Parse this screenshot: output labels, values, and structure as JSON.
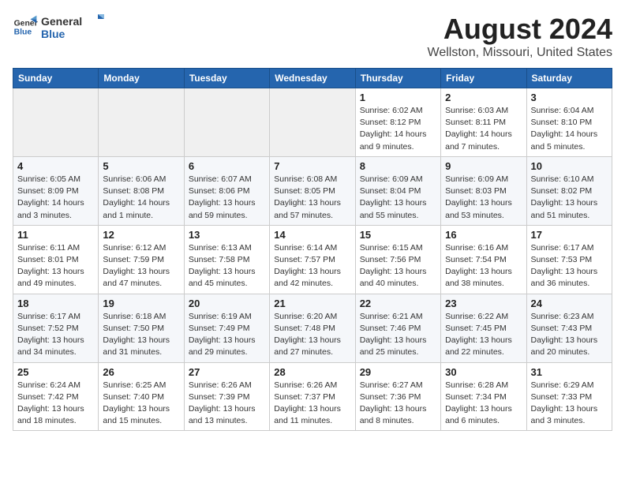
{
  "header": {
    "logo": {
      "line1": "General",
      "line2": "Blue"
    },
    "title": "August 2024",
    "subtitle": "Wellston, Missouri, United States"
  },
  "days_of_week": [
    "Sunday",
    "Monday",
    "Tuesday",
    "Wednesday",
    "Thursday",
    "Friday",
    "Saturday"
  ],
  "weeks": [
    [
      {
        "day": "",
        "info": ""
      },
      {
        "day": "",
        "info": ""
      },
      {
        "day": "",
        "info": ""
      },
      {
        "day": "",
        "info": ""
      },
      {
        "day": "1",
        "info": "Sunrise: 6:02 AM\nSunset: 8:12 PM\nDaylight: 14 hours\nand 9 minutes."
      },
      {
        "day": "2",
        "info": "Sunrise: 6:03 AM\nSunset: 8:11 PM\nDaylight: 14 hours\nand 7 minutes."
      },
      {
        "day": "3",
        "info": "Sunrise: 6:04 AM\nSunset: 8:10 PM\nDaylight: 14 hours\nand 5 minutes."
      }
    ],
    [
      {
        "day": "4",
        "info": "Sunrise: 6:05 AM\nSunset: 8:09 PM\nDaylight: 14 hours\nand 3 minutes."
      },
      {
        "day": "5",
        "info": "Sunrise: 6:06 AM\nSunset: 8:08 PM\nDaylight: 14 hours\nand 1 minute."
      },
      {
        "day": "6",
        "info": "Sunrise: 6:07 AM\nSunset: 8:06 PM\nDaylight: 13 hours\nand 59 minutes."
      },
      {
        "day": "7",
        "info": "Sunrise: 6:08 AM\nSunset: 8:05 PM\nDaylight: 13 hours\nand 57 minutes."
      },
      {
        "day": "8",
        "info": "Sunrise: 6:09 AM\nSunset: 8:04 PM\nDaylight: 13 hours\nand 55 minutes."
      },
      {
        "day": "9",
        "info": "Sunrise: 6:09 AM\nSunset: 8:03 PM\nDaylight: 13 hours\nand 53 minutes."
      },
      {
        "day": "10",
        "info": "Sunrise: 6:10 AM\nSunset: 8:02 PM\nDaylight: 13 hours\nand 51 minutes."
      }
    ],
    [
      {
        "day": "11",
        "info": "Sunrise: 6:11 AM\nSunset: 8:01 PM\nDaylight: 13 hours\nand 49 minutes."
      },
      {
        "day": "12",
        "info": "Sunrise: 6:12 AM\nSunset: 7:59 PM\nDaylight: 13 hours\nand 47 minutes."
      },
      {
        "day": "13",
        "info": "Sunrise: 6:13 AM\nSunset: 7:58 PM\nDaylight: 13 hours\nand 45 minutes."
      },
      {
        "day": "14",
        "info": "Sunrise: 6:14 AM\nSunset: 7:57 PM\nDaylight: 13 hours\nand 42 minutes."
      },
      {
        "day": "15",
        "info": "Sunrise: 6:15 AM\nSunset: 7:56 PM\nDaylight: 13 hours\nand 40 minutes."
      },
      {
        "day": "16",
        "info": "Sunrise: 6:16 AM\nSunset: 7:54 PM\nDaylight: 13 hours\nand 38 minutes."
      },
      {
        "day": "17",
        "info": "Sunrise: 6:17 AM\nSunset: 7:53 PM\nDaylight: 13 hours\nand 36 minutes."
      }
    ],
    [
      {
        "day": "18",
        "info": "Sunrise: 6:17 AM\nSunset: 7:52 PM\nDaylight: 13 hours\nand 34 minutes."
      },
      {
        "day": "19",
        "info": "Sunrise: 6:18 AM\nSunset: 7:50 PM\nDaylight: 13 hours\nand 31 minutes."
      },
      {
        "day": "20",
        "info": "Sunrise: 6:19 AM\nSunset: 7:49 PM\nDaylight: 13 hours\nand 29 minutes."
      },
      {
        "day": "21",
        "info": "Sunrise: 6:20 AM\nSunset: 7:48 PM\nDaylight: 13 hours\nand 27 minutes."
      },
      {
        "day": "22",
        "info": "Sunrise: 6:21 AM\nSunset: 7:46 PM\nDaylight: 13 hours\nand 25 minutes."
      },
      {
        "day": "23",
        "info": "Sunrise: 6:22 AM\nSunset: 7:45 PM\nDaylight: 13 hours\nand 22 minutes."
      },
      {
        "day": "24",
        "info": "Sunrise: 6:23 AM\nSunset: 7:43 PM\nDaylight: 13 hours\nand 20 minutes."
      }
    ],
    [
      {
        "day": "25",
        "info": "Sunrise: 6:24 AM\nSunset: 7:42 PM\nDaylight: 13 hours\nand 18 minutes."
      },
      {
        "day": "26",
        "info": "Sunrise: 6:25 AM\nSunset: 7:40 PM\nDaylight: 13 hours\nand 15 minutes."
      },
      {
        "day": "27",
        "info": "Sunrise: 6:26 AM\nSunset: 7:39 PM\nDaylight: 13 hours\nand 13 minutes."
      },
      {
        "day": "28",
        "info": "Sunrise: 6:26 AM\nSunset: 7:37 PM\nDaylight: 13 hours\nand 11 minutes."
      },
      {
        "day": "29",
        "info": "Sunrise: 6:27 AM\nSunset: 7:36 PM\nDaylight: 13 hours\nand 8 minutes."
      },
      {
        "day": "30",
        "info": "Sunrise: 6:28 AM\nSunset: 7:34 PM\nDaylight: 13 hours\nand 6 minutes."
      },
      {
        "day": "31",
        "info": "Sunrise: 6:29 AM\nSunset: 7:33 PM\nDaylight: 13 hours\nand 3 minutes."
      }
    ]
  ]
}
